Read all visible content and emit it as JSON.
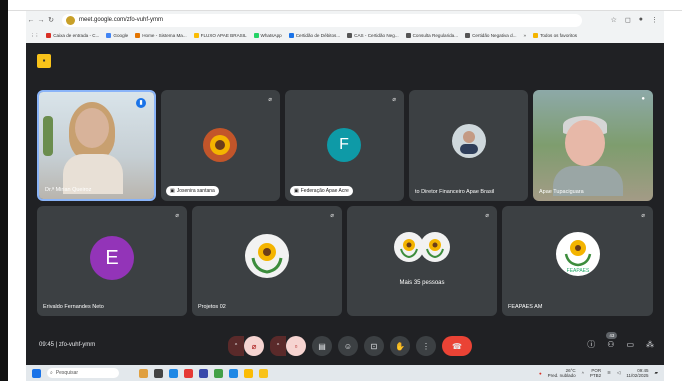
{
  "browser": {
    "url": "meet.google.com/zfo-vuhf-ymm",
    "bookmarks": [
      "Caixa de entrada - C...",
      "Google",
      "Home - Sistema Ma...",
      "FLUXO APAE BRASIL",
      "WhatsApp",
      "Certidão de Débitos...",
      "CAS - Certidão Neg...",
      "Consulta Regularida...",
      "Certidão Negativa d..."
    ],
    "overflow": "»",
    "all_bookmarks": "Todos os favoritos"
  },
  "tiles": [
    {
      "name": "Dr.ª Mirian Queiroz"
    },
    {
      "name": "Josenira santana"
    },
    {
      "name": "Federação Apae Acre",
      "initial": "F"
    },
    {
      "name": "to Diretor Financeiro Apae Brasil"
    },
    {
      "name": "Apae Tupaciguara"
    },
    {
      "name": "Erivaldo Fernandes Neto",
      "initial": "E"
    },
    {
      "name": "Projetos 02"
    },
    {
      "name": "Mais 35 pessoas"
    },
    {
      "name": "FEAPAES AM"
    }
  ],
  "meeting": {
    "time": "09:45",
    "separator": " | ",
    "code": "zfo-vuhf-ymm",
    "participant_count": "43"
  },
  "taskbar": {
    "search_placeholder": "Pesquisar",
    "temperature": "26°C",
    "weather_text": "Pred. nublado",
    "lang": "POR",
    "layout": "PTB2",
    "time": "09:45",
    "date": "11/02/2025"
  },
  "colors": {
    "meet_background": "#202124",
    "tile_background": "#3c4043",
    "hangup_red": "#ea4335",
    "active_speaker_border": "#8ab4f8"
  }
}
